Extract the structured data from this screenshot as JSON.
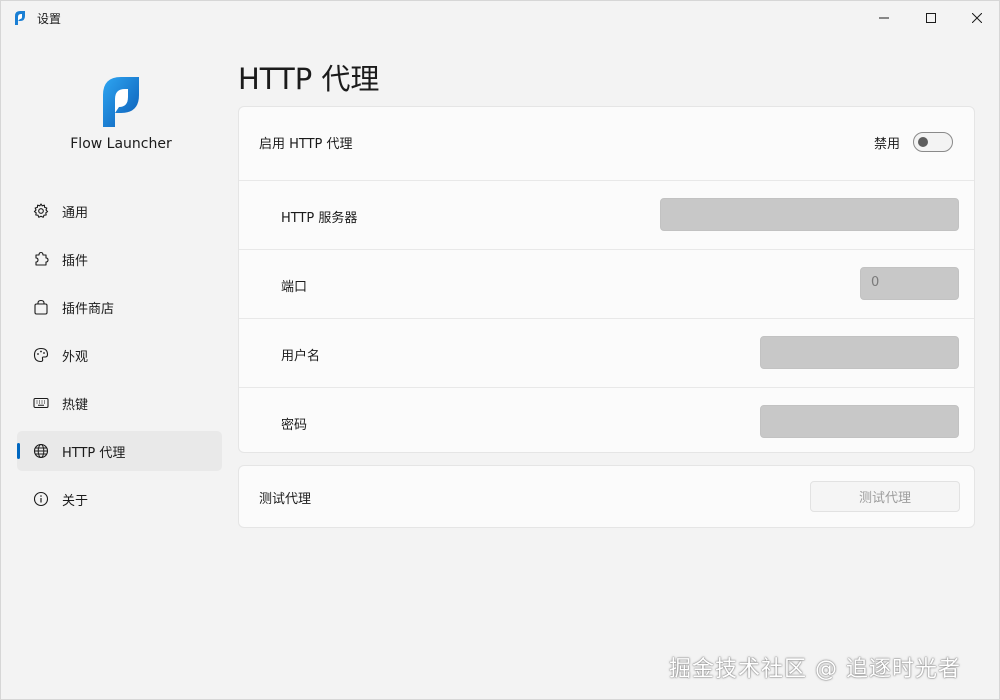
{
  "window": {
    "title": "设置",
    "icons": {
      "app": "flow-launcher-icon",
      "minimize": "minimize-icon",
      "maximize": "maximize-icon",
      "close": "close-icon"
    }
  },
  "sidebar": {
    "brand": "Flow Launcher",
    "items": [
      {
        "label": "通用",
        "icon": "gear-icon",
        "active": false
      },
      {
        "label": "插件",
        "icon": "puzzle-icon",
        "active": false
      },
      {
        "label": "插件商店",
        "icon": "shopping-bag-icon",
        "active": false
      },
      {
        "label": "外观",
        "icon": "palette-icon",
        "active": false
      },
      {
        "label": "热键",
        "icon": "keyboard-icon",
        "active": false
      },
      {
        "label": "HTTP 代理",
        "icon": "globe-icon",
        "active": true
      },
      {
        "label": "关于",
        "icon": "info-icon",
        "active": false
      }
    ],
    "accent": "#0067c0"
  },
  "main": {
    "title": "HTTP 代理",
    "enable_proxy": {
      "label": "启用 HTTP 代理",
      "state_text": "禁用",
      "enabled": false
    },
    "fields": {
      "server": {
        "label": "HTTP 服务器",
        "value": ""
      },
      "port": {
        "label": "端口",
        "value": "0"
      },
      "username": {
        "label": "用户名",
        "value": ""
      },
      "password": {
        "label": "密码",
        "value": ""
      }
    },
    "test": {
      "label": "测试代理",
      "button_label": "测试代理"
    }
  },
  "watermark": "掘金技术社区 @ 追逐时光者"
}
